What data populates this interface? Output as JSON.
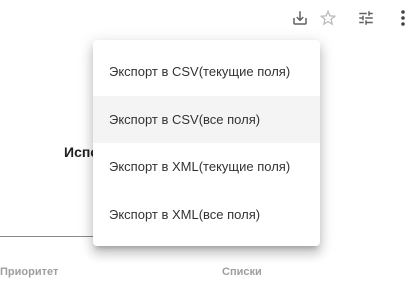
{
  "toolbar": {
    "icons": [
      "download-icon",
      "star-outline-icon",
      "tune-icon",
      "more-vert-icon"
    ]
  },
  "background": {
    "partial_label": "Исполнитель",
    "columns": {
      "priority": "Приоритет",
      "lists": "Списки"
    }
  },
  "export_menu": {
    "items": [
      {
        "label": "Экспорт в CSV(текущие поля)"
      },
      {
        "label": "Экспорт в CSV(все поля)",
        "highlighted": true
      },
      {
        "label": "Экспорт в XML(текущие поля)"
      },
      {
        "label": "Экспорт в XML(все поля)"
      }
    ]
  },
  "colors": {
    "icon": "#616161",
    "star": "#bdbdbd",
    "hover": "#f4f4f4",
    "muted_text": "#9e9e9e"
  }
}
